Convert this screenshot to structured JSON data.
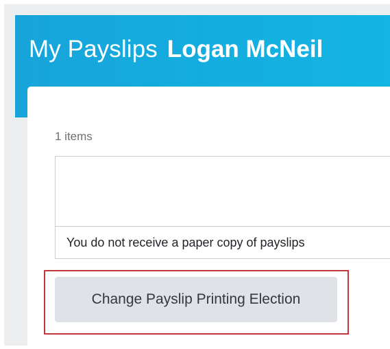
{
  "header": {
    "title": "My Payslips",
    "subtitle": "Logan McNeil"
  },
  "results": {
    "count_label": "1 items"
  },
  "table": {
    "rows": [
      {
        "text": "You do not receive a paper copy of payslips"
      }
    ]
  },
  "actions": {
    "change_printing_election_label": "Change Payslip Printing Election"
  },
  "colors": {
    "header_band": "#17a4da",
    "highlight_border": "#c0363a",
    "button_bg": "#dfe3e7",
    "page_bg": "#eceef0"
  }
}
